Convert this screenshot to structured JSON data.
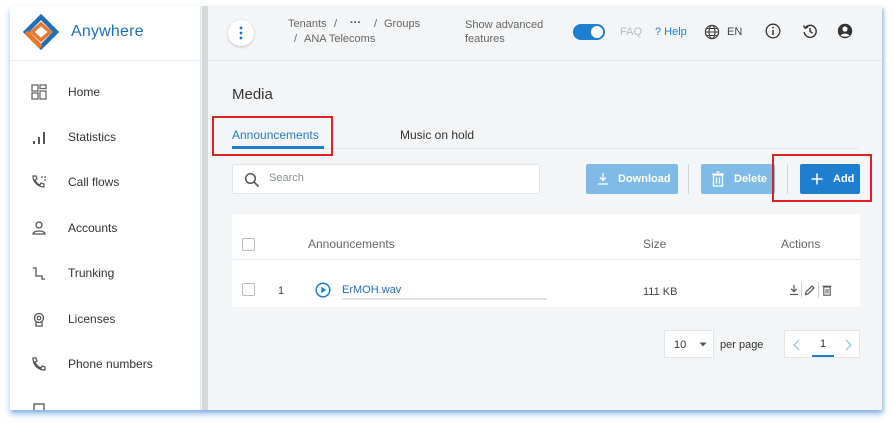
{
  "app": {
    "name": "Anywhere"
  },
  "sidebar": {
    "items": [
      {
        "label": "Home",
        "icon": "dashboard-icon"
      },
      {
        "label": "Statistics",
        "icon": "bar-chart-icon"
      },
      {
        "label": "Call flows",
        "icon": "call-flow-icon"
      },
      {
        "label": "Accounts",
        "icon": "user-icon"
      },
      {
        "label": "Trunking",
        "icon": "trunk-icon"
      },
      {
        "label": "Licenses",
        "icon": "license-icon"
      },
      {
        "label": "Phone numbers",
        "icon": "phone-icon"
      }
    ]
  },
  "topbar": {
    "breadcrumb": {
      "tenants": "Tenants",
      "sep": "/",
      "ellipsis": "···",
      "groups": "Groups",
      "current_prefix": "/",
      "current": "ANA Telecoms"
    },
    "advanced_label_line1": "Show advanced",
    "advanced_label_line2": "features",
    "advanced_enabled": true,
    "faq": "FAQ",
    "help": "? Help",
    "language": "EN"
  },
  "page": {
    "title": "Media",
    "tabs": [
      {
        "label": "Announcements",
        "active": true
      },
      {
        "label": "Music on hold",
        "active": false
      }
    ]
  },
  "toolbar": {
    "search_placeholder": "Search",
    "download_label": "Download",
    "delete_label": "Delete",
    "add_label": "Add"
  },
  "table": {
    "columns": [
      "Announcements",
      "Size",
      "Actions"
    ],
    "rows": [
      {
        "index": "1",
        "name": "ErMOH.wav",
        "size": "111 KB",
        "playback_progress": 0
      }
    ]
  },
  "pagination": {
    "per_page_value": "10",
    "per_page_label": "per page",
    "current_page": "1"
  },
  "colors": {
    "accent": "#1e7fd0",
    "brand_blue": "#1e6fb8",
    "brand_orange": "#e8762b",
    "button_disabled": "#7fbbe6",
    "highlight_box": "#e02020"
  }
}
